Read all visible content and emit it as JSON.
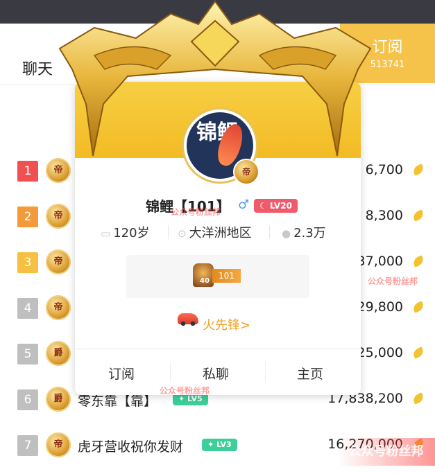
{
  "header": {
    "chat_tab": "聊天",
    "subscribe_label": "订阅",
    "subscribe_count": "513741"
  },
  "ranking": [
    {
      "rank": "1",
      "badge": "帝",
      "name": "",
      "tag": "",
      "amount": "6,700"
    },
    {
      "rank": "2",
      "badge": "帝",
      "name": "",
      "tag": "",
      "amount": "8,300"
    },
    {
      "rank": "3",
      "badge": "帝",
      "name": "",
      "tag": "",
      "amount": "37,000"
    },
    {
      "rank": "4",
      "badge": "帝",
      "name": "",
      "tag": "",
      "amount": "29,800"
    },
    {
      "rank": "5",
      "badge": "爵",
      "name": "",
      "tag": "",
      "amount": "25,000"
    },
    {
      "rank": "6",
      "badge": "爵",
      "name": "零东靠【靠】",
      "tag": "LV5",
      "amount": "17,838,200"
    },
    {
      "rank": "7",
      "badge": "帝",
      "name": "虎牙营收祝你发财",
      "tag": "LV3",
      "amount": "16,270,000"
    }
  ],
  "rank_colors": [
    "#f05050",
    "#f39a3a",
    "#f6c042",
    "#bfbfbf",
    "#bfbfbf",
    "#bfbfbf",
    "#bfbfbf"
  ],
  "profile": {
    "avatar_text": "锦鲤",
    "avatar_badge": "帝",
    "name": "锦鲤【101】",
    "gender": "♂",
    "level": "LV20",
    "age": "120岁",
    "region": "大洋洲地区",
    "fans": "2.3万",
    "medal_level": "40",
    "medal_name": "101",
    "honor_link": "火先锋>",
    "actions": {
      "subscribe": "订阅",
      "message": "私聊",
      "homepage": "主页"
    }
  },
  "icons": {
    "age": "id-card-icon",
    "region": "location-pin-icon",
    "fans": "fans-icon",
    "currency": "gold-leaf-icon"
  },
  "watermarks": [
    "公众号粉丝邦",
    "公众号粉丝邦",
    "公众号粉丝邦",
    "公众号粉丝邦"
  ]
}
